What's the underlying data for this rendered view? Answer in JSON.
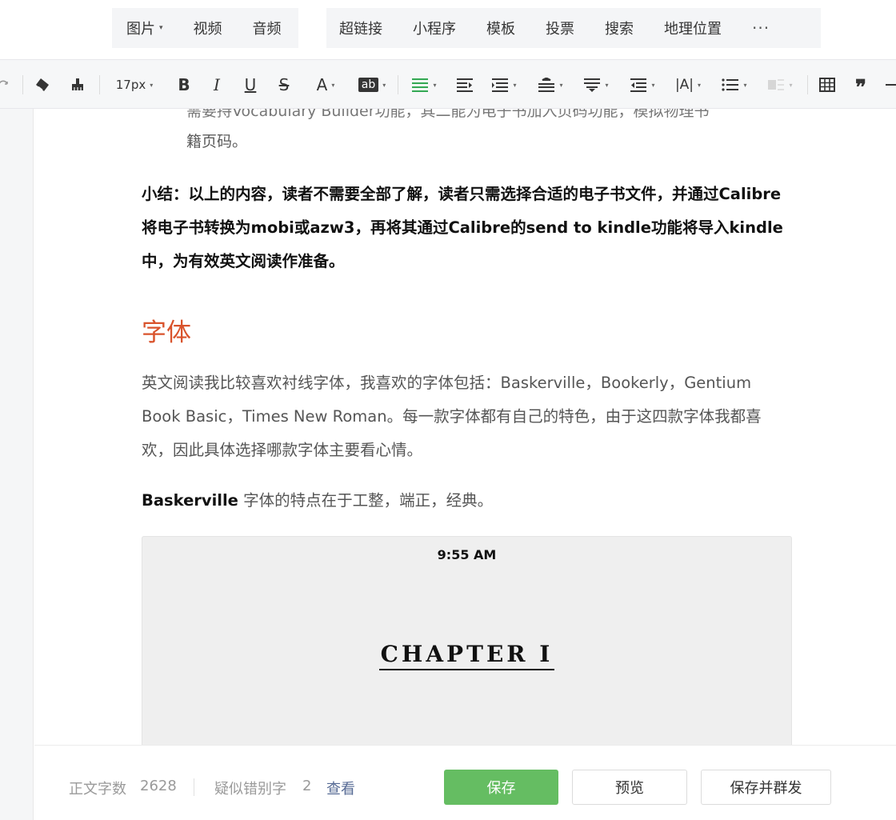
{
  "insert_bar": {
    "group1": [
      {
        "label": "图片",
        "has_caret": true
      },
      {
        "label": "视频"
      },
      {
        "label": "音频"
      }
    ],
    "group2": [
      {
        "label": "超链接"
      },
      {
        "label": "小程序"
      },
      {
        "label": "模板"
      },
      {
        "label": "投票"
      },
      {
        "label": "搜索"
      },
      {
        "label": "地理位置"
      }
    ],
    "more_label": "···"
  },
  "toolbar": {
    "font_size": "17px",
    "bold": "B",
    "italic": "I",
    "underline": "U",
    "strikethrough": "S",
    "font_color": "A",
    "bg_color": "ab",
    "colors": {
      "highlight": "#33a853",
      "icon": "#353535"
    }
  },
  "content": {
    "cut_line": "需要持Vocabulary Builder功能，其二能为电子书加入页码功能，模拟物理书",
    "list_line": "籍页码。",
    "summary": "小结：以上的内容，读者不需要全部了解，读者只需选择合适的电子书文件，并通过Calibre将电子书转换为mobi或azw3，再将其通过Calibre的send to kindle功能将导入kindle中，为有效英文阅读作准备。",
    "heading": "字体",
    "paragraph": "英文阅读我比较喜欢衬线字体，我喜欢的字体包括：Baskerville，Bookerly，Gentium Book Basic，Times New Roman。每一款字体都有自己的特色，由于这四款字体我都喜欢，因此具体选择哪款字体主要看心情。",
    "desc_bold": "Baskerville",
    "desc_rest": " 字体的特点在于工整，端正，经典。",
    "image": {
      "time": "9:55 AM",
      "chapter": "CHAPTER I"
    },
    "heading_color": "#d9532c"
  },
  "footer": {
    "word_count_label": "正文字数",
    "word_count": "2628",
    "typo_label": "疑似错别字",
    "typo_count": "2",
    "view_link": "查看",
    "save": "保存",
    "preview": "预览",
    "save_mass": "保存并群发",
    "colors": {
      "save_bg": "#65bd62",
      "link": "#576b95"
    }
  }
}
